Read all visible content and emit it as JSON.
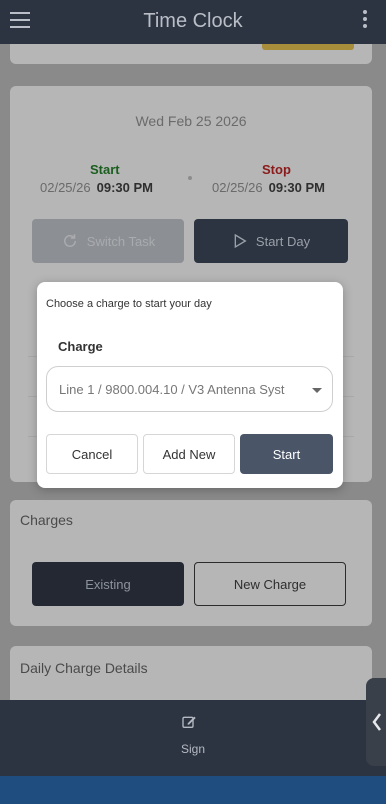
{
  "header": {
    "title": "Time Clock",
    "menu_icon": "hamburger-icon",
    "more_icon": "kebab-menu-icon"
  },
  "shift": {
    "date": "Wed Feb 25 2026",
    "start_label": "Start",
    "start_date": "02/25/26",
    "start_time": "09:30 PM",
    "stop_label": "Stop",
    "stop_date": "02/25/26",
    "stop_time": "09:30 PM",
    "switch_task_label": "Switch Task",
    "start_day_label": "Start Day"
  },
  "charges": {
    "title": "Charges",
    "existing_label": "Existing",
    "new_charge_label": "New Charge"
  },
  "daily": {
    "title": "Daily Charge Details"
  },
  "bottom_nav": {
    "sign_label": "Sign",
    "sign_icon": "edit-icon",
    "side_tab_icon": "chevron-left-icon"
  },
  "modal": {
    "prompt": "Choose a charge to start your day",
    "charge_label": "Charge",
    "selected_charge": "Line 1 / 9800.004.10 / V3 Antenna Syst",
    "cancel_label": "Cancel",
    "add_new_label": "Add New",
    "start_label": "Start"
  },
  "colors": {
    "primary_dark": "#2c3442",
    "start_green": "#1b5e20",
    "stop_red": "#8b1a1a",
    "accent_yellow": "#a88e3a"
  }
}
